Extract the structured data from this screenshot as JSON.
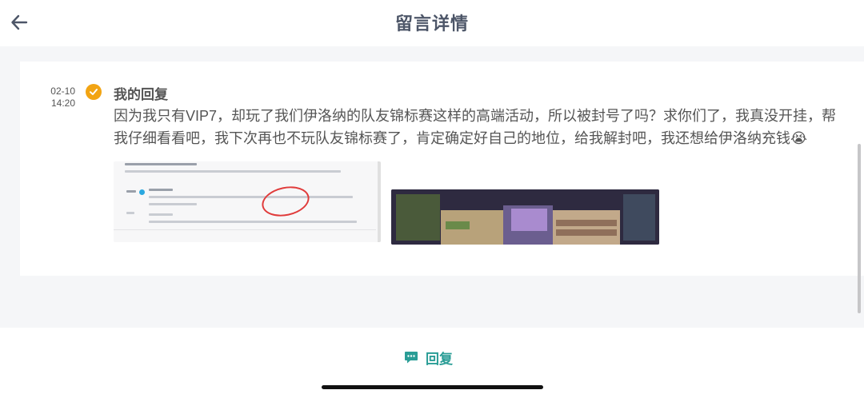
{
  "header": {
    "title": "留言详情"
  },
  "message": {
    "date": "02-10",
    "time": "14:20",
    "title": "我的回复",
    "text": "因为我只有VIP7，却玩了我们伊洛纳的队友锦标赛这样的高端活动，所以被封号了吗？求你们了，我真没开挂，帮我仔细看看吧，我下次再也不玩队友锦标赛了，肯定确定好自己的地位，给我解封吧，我还想给伊洛纳充钱😭"
  },
  "attachments": [
    {
      "icon": "screenshot-thumbnail"
    },
    {
      "icon": "game-screenshot-thumbnail"
    }
  ],
  "footer": {
    "reply_label": "回复"
  },
  "colors": {
    "accent": "#2a9d96",
    "check": "#f2a413",
    "title": "#4d5668"
  }
}
